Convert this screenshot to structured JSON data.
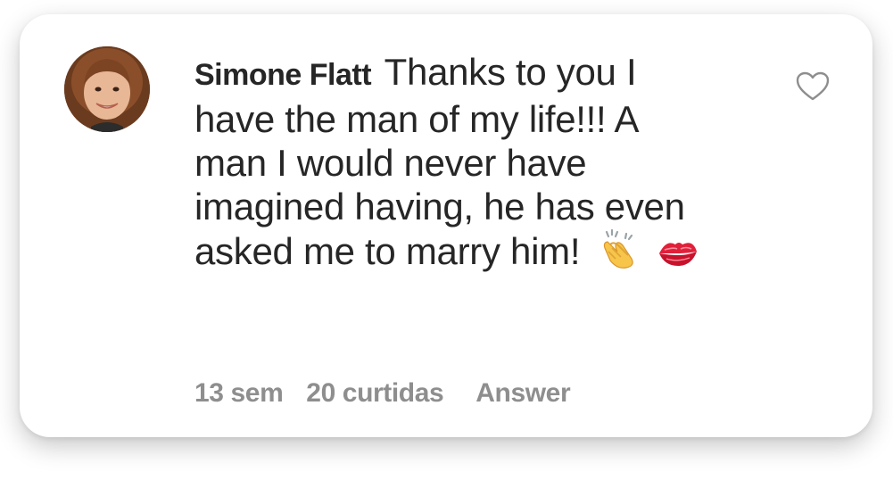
{
  "comment": {
    "username": "Simone Flatt",
    "text": "Thanks to you I have the man of my life!!! A man I would never have imagined having, he has even asked me to marry him!",
    "emojis": [
      "clapping-hands-icon",
      "kiss-mark-icon"
    ]
  },
  "meta": {
    "time": "13 sem",
    "likes": "20 curtidas",
    "reply_label": "Answer"
  },
  "icons": {
    "like": "heart-outline-icon"
  },
  "colors": {
    "text": "#262626",
    "meta": "#8e8e8e",
    "background": "#ffffff"
  }
}
